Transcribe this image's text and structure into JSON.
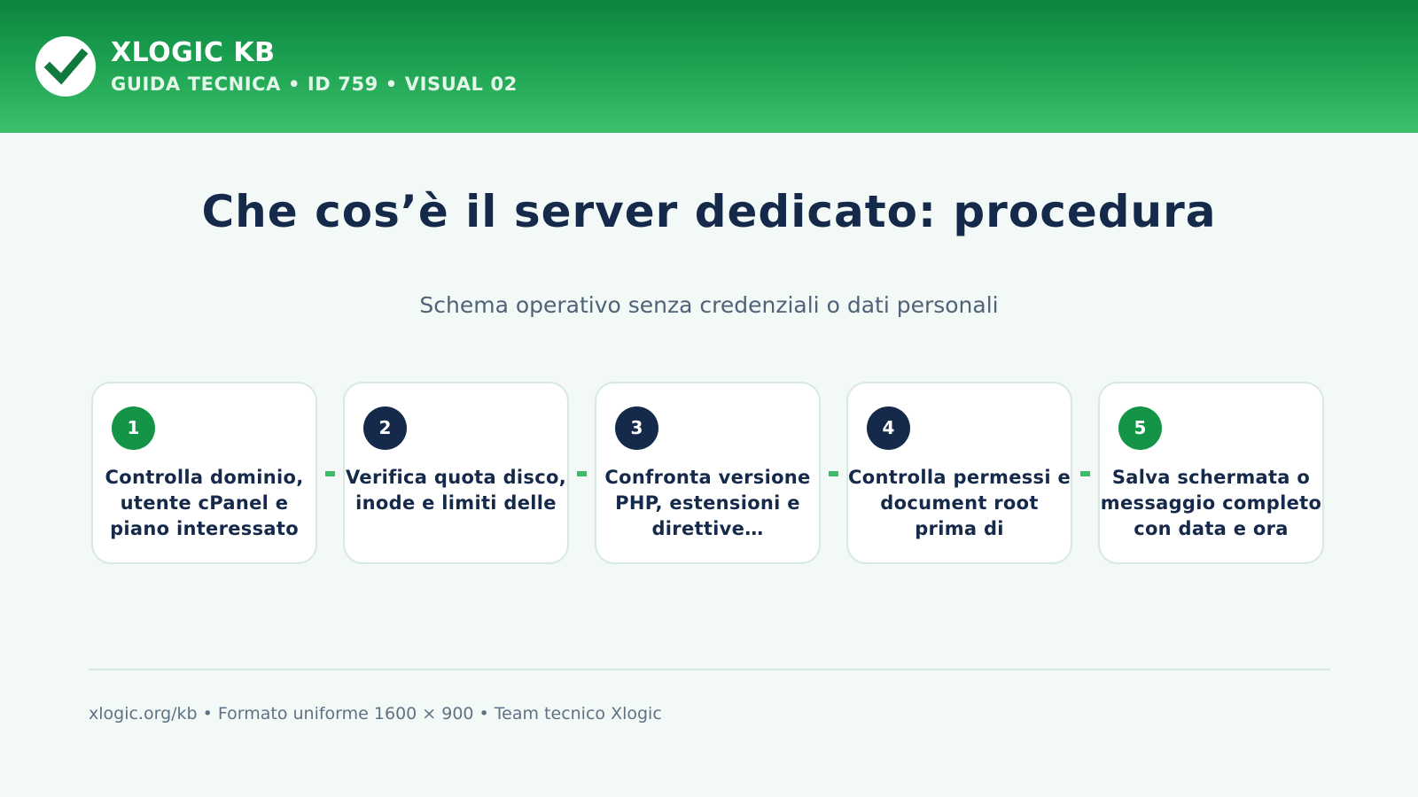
{
  "colors": {
    "header_green": "#1ea352",
    "title_navy": "#15294a",
    "step_green": "#139447",
    "step_navy": "#15294a",
    "connector_green": "#3cbb68"
  },
  "header": {
    "logo_icon": "checkmark-icon",
    "brand_name": "XLOGIC KB",
    "brand_subtitle": "GUIDA TECNICA • ID 759 • VISUAL 02"
  },
  "title": "Che cos’è il server dedicato: procedura",
  "subtitle": "Schema operativo senza credenziali o dati personali",
  "steps": [
    {
      "number": "1",
      "color": "green",
      "text": "Controlla dominio, utente cPanel e piano interessato"
    },
    {
      "number": "2",
      "color": "navy",
      "text": "Verifica quota disco, inode e limiti delle"
    },
    {
      "number": "3",
      "color": "navy",
      "text": "Confronta versione PHP, estensioni e direttive…"
    },
    {
      "number": "4",
      "color": "navy",
      "text": "Controlla permessi e document root prima di"
    },
    {
      "number": "5",
      "color": "green",
      "text": "Salva schermata o messaggio completo con data e ora"
    }
  ],
  "footer": {
    "text": "xlogic.org/kb • Formato uniforme 1600 × 900 • Team tecnico Xlogic"
  }
}
